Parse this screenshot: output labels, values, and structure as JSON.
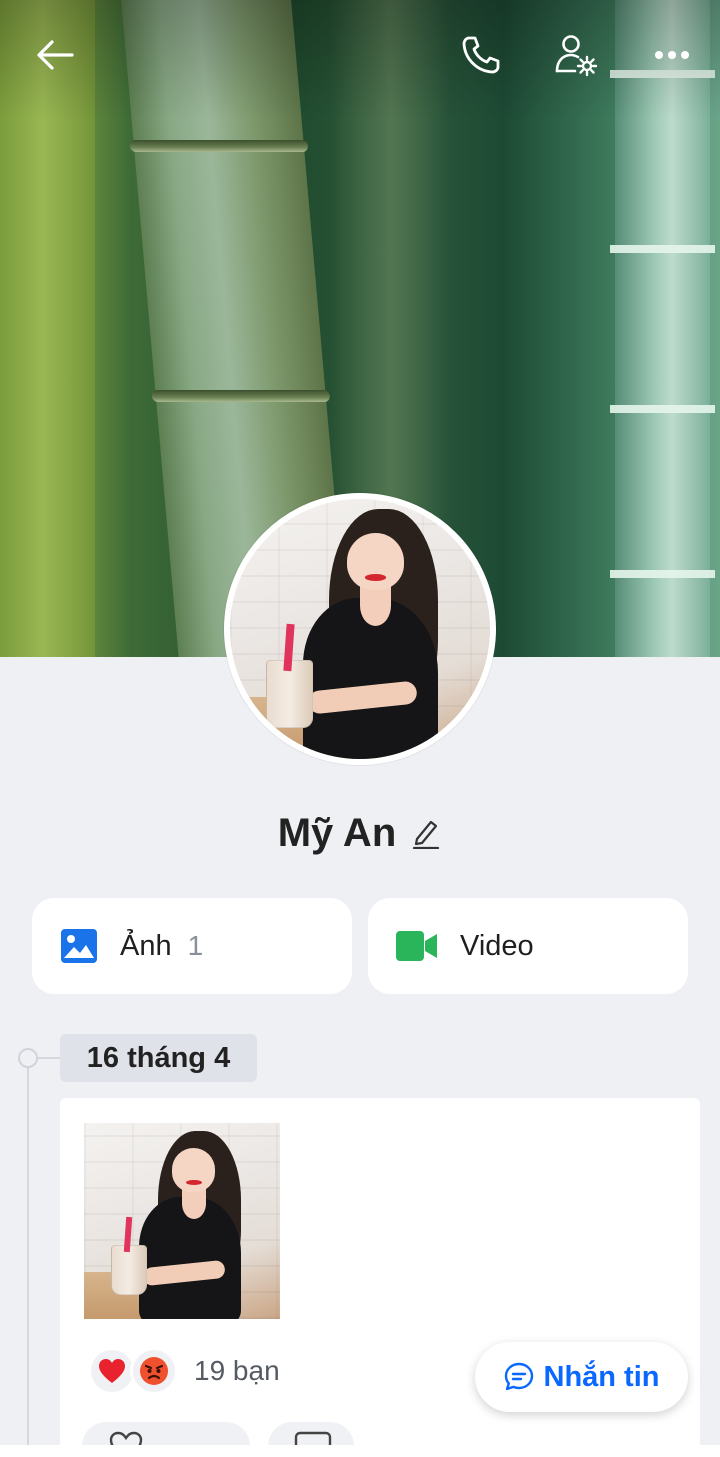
{
  "topbar": {
    "back_icon": "arrow-left-icon",
    "call_icon": "phone-icon",
    "settings_icon": "user-settings-icon",
    "more_icon": "more-horizontal-icon"
  },
  "profile": {
    "name": "Mỹ An",
    "edit_icon": "pencil-icon"
  },
  "media": {
    "photos_label": "Ảnh",
    "photos_count": "1",
    "photos_icon": "image-icon",
    "video_label": "Video",
    "video_icon": "video-camera-icon"
  },
  "timeline": {
    "date": "16 tháng 4",
    "post": {
      "reactions": [
        "heart",
        "angry"
      ],
      "reaction_text": "19 bạn"
    }
  },
  "message_button": {
    "label": "Nhắn tin",
    "icon": "chat-bubble-icon"
  },
  "colors": {
    "accent": "#0a68ff",
    "video_icon": "#2bb55a",
    "background": "#eef0f4"
  }
}
